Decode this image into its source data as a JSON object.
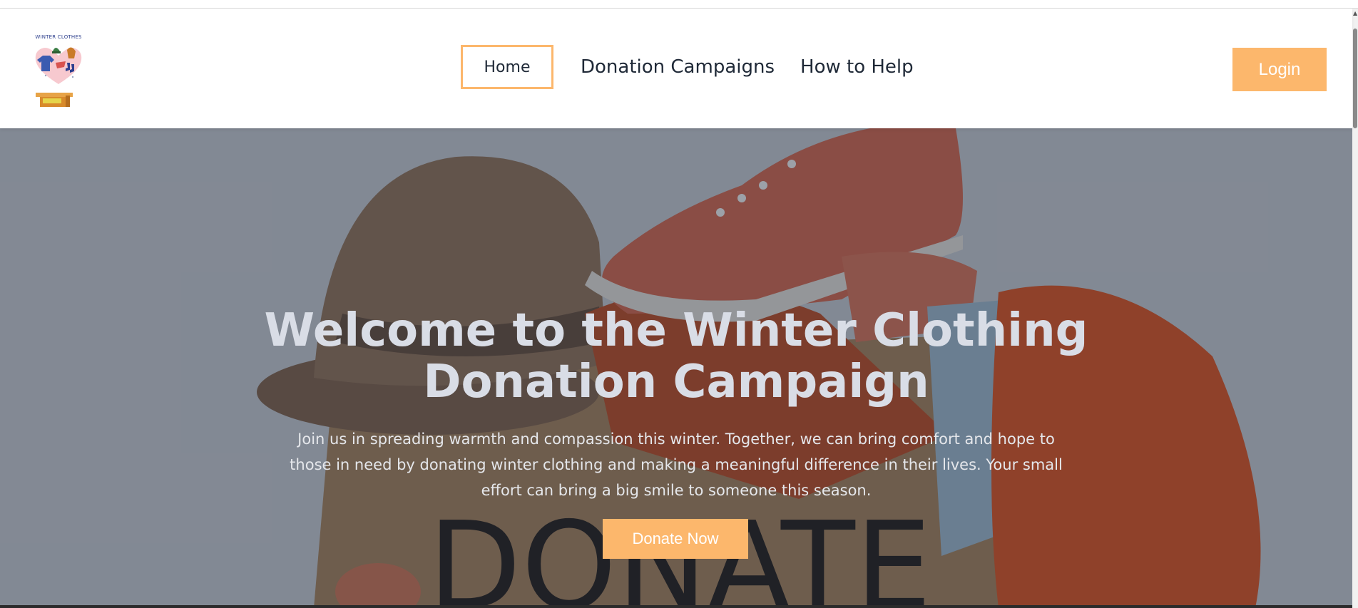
{
  "logo": {
    "text": "WINTER CLOTHES"
  },
  "nav": {
    "items": [
      {
        "label": "Home",
        "active": true
      },
      {
        "label": "Donation Campaigns",
        "active": false
      },
      {
        "label": "How to Help",
        "active": false
      }
    ]
  },
  "header": {
    "login_label": "Login"
  },
  "hero": {
    "title": "Welcome to the Winter Clothing Donation Campaign",
    "subtitle": "Join us in spreading warmth and compassion this winter. Together, we can bring comfort and hope to those in need by donating winter clothing and making a meaningful difference in their lives. Your small effort can bring a big smile to someone this season.",
    "cta_label": "Donate Now",
    "background_text": "DONATE"
  },
  "colors": {
    "accent": "#fcb76c",
    "nav_text": "#1f2937",
    "hero_title": "#d9dde6"
  }
}
